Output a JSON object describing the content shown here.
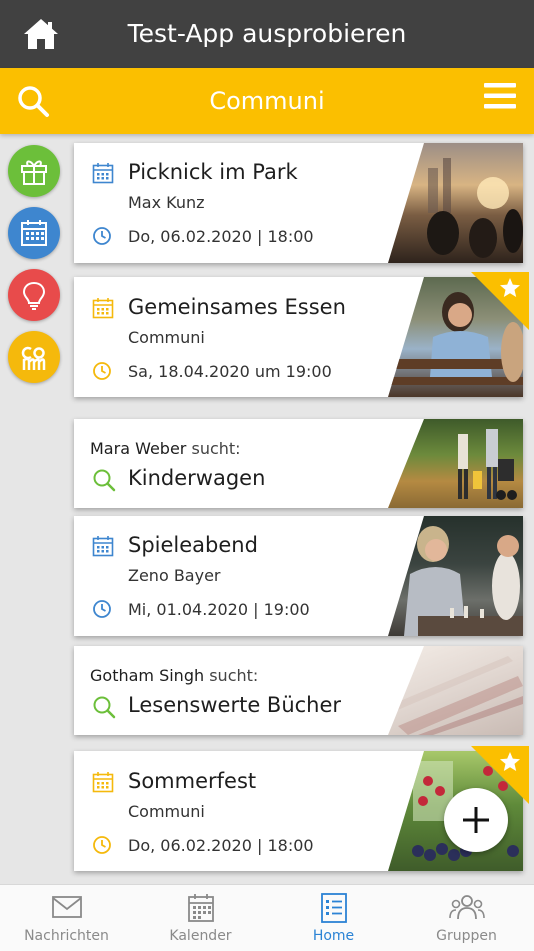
{
  "header": {
    "title": "Test-App ausprobieren"
  },
  "subheader": {
    "title": "Communi"
  },
  "side_buttons": [
    {
      "name": "gift",
      "color": "#6cbf3a"
    },
    {
      "name": "calendar",
      "color": "#3e86cf"
    },
    {
      "name": "idea",
      "color": "#e84b4b"
    },
    {
      "name": "communi",
      "color": "#f5b90c"
    }
  ],
  "cards": [
    {
      "type": "event",
      "title": "Picknick im Park",
      "organizer": "Max Kunz",
      "datetime": "Do, 06.02.2020 | 18:00",
      "accent": "#3e86cf",
      "featured": false
    },
    {
      "type": "event",
      "title": "Gemeinsames Essen",
      "organizer": "Communi",
      "datetime": "Sa, 18.04.2020 um 19:00",
      "accent": "#f5b90c",
      "featured": true
    },
    {
      "type": "search",
      "person": "Mara Weber",
      "verb": "sucht:",
      "title": "Kinderwagen"
    },
    {
      "type": "event",
      "title": "Spieleabend",
      "organizer": "Zeno Bayer",
      "datetime": "Mi, 01.04.2020 | 19:00",
      "accent": "#3e86cf",
      "featured": false
    },
    {
      "type": "search",
      "person": "Gotham Singh",
      "verb": "sucht:",
      "title": "Lesenswerte Bücher"
    },
    {
      "type": "event",
      "title": "Sommerfest",
      "organizer": "Communi",
      "datetime": "Do, 06.02.2020 | 18:00",
      "accent": "#f5b90c",
      "featured": true
    }
  ],
  "tabs": [
    {
      "label": "Nachrichten",
      "icon": "envelope-icon",
      "active": false
    },
    {
      "label": "Kalender",
      "icon": "calendar-icon",
      "active": false
    },
    {
      "label": "Home",
      "icon": "list-icon",
      "active": true
    },
    {
      "label": "Gruppen",
      "icon": "group-icon",
      "active": false
    }
  ],
  "colors": {
    "topbar": "#414141",
    "brand_yellow": "#fbbf00",
    "active_tab": "#2b83d5",
    "search_green": "#6cbf3a"
  }
}
